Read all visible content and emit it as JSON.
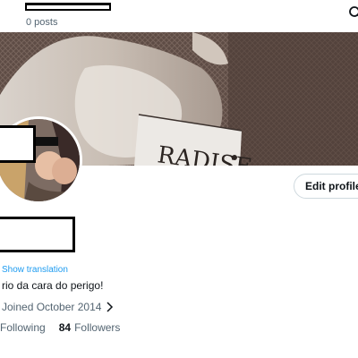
{
  "header": {
    "posts_count": "0 posts",
    "search_icon": "search-icon"
  },
  "banner": {
    "image_text": "RADISE"
  },
  "profile": {
    "edit_profile_label": "Edit profile",
    "show_translation_label": "Show translation",
    "bio": "rio da cara do perigo!",
    "joined": "Joined October 2014",
    "following_label": "Following",
    "followers_count": "84",
    "followers_label": "Followers"
  },
  "colors": {
    "link": "#1d9bf0",
    "secondary_text": "#536471",
    "primary_text": "#0f1419",
    "border": "#cfd9de"
  }
}
